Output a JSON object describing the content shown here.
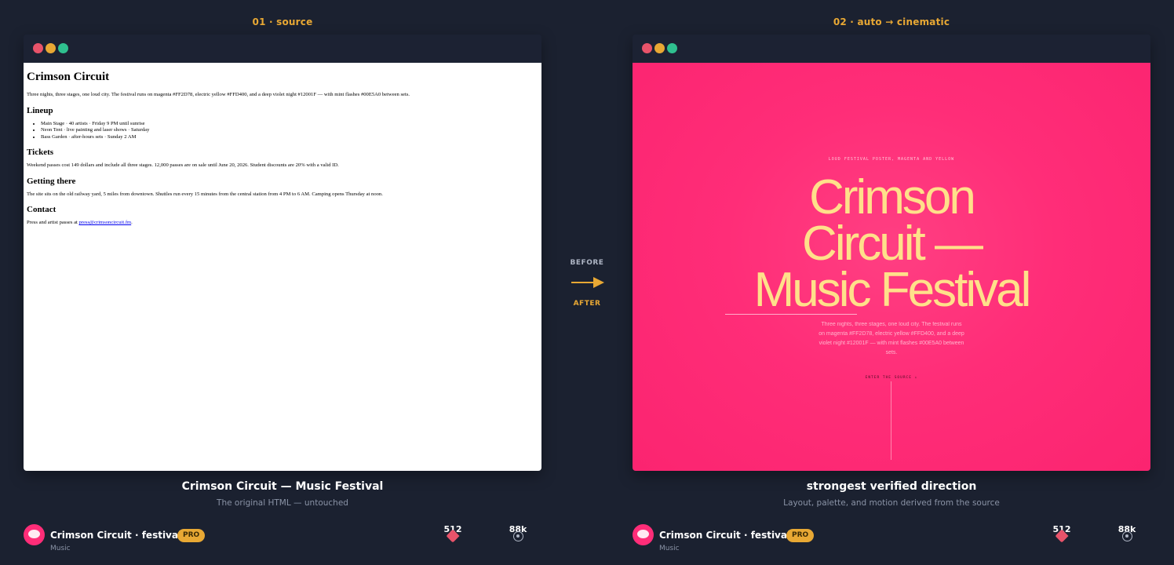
{
  "panels": {
    "left": {
      "label": "01 · source",
      "caption_title": "Crimson Circuit — Music Festival",
      "caption_sub": "The original HTML — untouched"
    },
    "right": {
      "label": "02 · auto → cinematic",
      "caption_title": "strongest verified direction",
      "caption_sub": "Layout, palette, and motion derived from the source"
    }
  },
  "source_doc": {
    "title": "Crimson Circuit",
    "intro": "Three nights, three stages, one loud city. The festival runs on magenta #FF2D78, electric yellow #FFD400, and a deep violet night #12001F — with mint flashes #00E5A0 between sets.",
    "lineup_heading": "Lineup",
    "lineup": [
      "Main Stage · 40 artists · Friday 9 PM until sunrise",
      "Neon Tent · live painting and laser shows · Saturday",
      "Bass Garden · after-hours sets · Sunday 2 AM"
    ],
    "tickets_heading": "Tickets",
    "tickets": "Weekend passes cost 149 dollars and include all three stages. 12,000 passes are on sale until June 20, 2026. Student discounts are 20% with a valid ID.",
    "getting_heading": "Getting there",
    "getting": "The site sits on the old railway yard, 5 miles from downtown. Shuttles run every 15 minutes from the central station from 4 PM to 6 AM. Camping opens Thursday at noon.",
    "contact_heading": "Contact",
    "contact_prefix": "Press and artist passes at ",
    "contact_email": "press@crimsoncircuit.fm",
    "contact_suffix": "."
  },
  "cinematic": {
    "kicker": "LOUD FESTIVAL POSTER, MAGENTA AND YELLOW",
    "title_line1": "Crimson",
    "title_line2": "Circuit —",
    "title_line3": "Music Festival",
    "subtitle": "Three nights, three stages, one loud city. The festival runs on magenta #FF2D78, electric yellow #FFD400, and a deep violet night #12001F — with mint flashes #00E5A0 between sets.",
    "cta": "ENTER THE SOURCE ↓"
  },
  "flow": {
    "before": "BEFORE",
    "after": "AFTER"
  },
  "footer": {
    "name": "Crimson Circuit · festival",
    "badge": "PRO",
    "category": "Music",
    "likes": "512",
    "views": "88k"
  },
  "colors": {
    "background": "#1b2130",
    "accent": "#e8a834",
    "magenta": "#ff2d78",
    "yellow": "#ffe08a"
  },
  "icons": [
    "heart-icon",
    "eye-icon",
    "arrow-right-icon"
  ]
}
